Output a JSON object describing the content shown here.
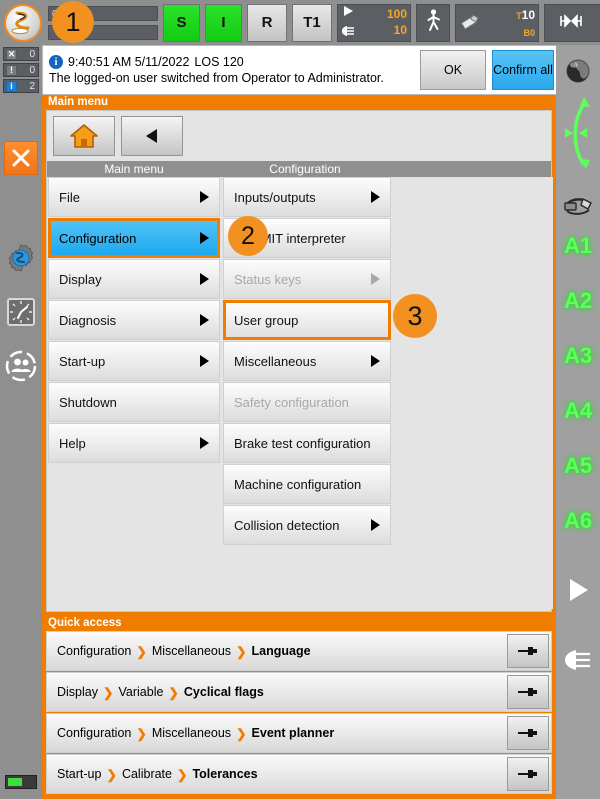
{
  "statusbar": {
    "robot_icon": "kuka-robot-icon",
    "submit_bars": [
      {
        "value": "0"
      },
      {
        "value": ""
      }
    ],
    "buttons": [
      {
        "name": "drives-ready-s",
        "label": "S",
        "state": "green"
      },
      {
        "name": "drives-i",
        "label": "I",
        "state": "green"
      },
      {
        "name": "robot-interpreter-r",
        "label": "R",
        "state": "gray"
      },
      {
        "name": "operating-mode-t1",
        "label": "T1",
        "state": "gray"
      }
    ],
    "override": {
      "program_value": "100",
      "jog_value": "10",
      "program_icon": "play-icon",
      "jog_icon": "hand-icon"
    },
    "increment_mode_icon": "walking-man-icon",
    "tool": {
      "icon": "tool-base-icon",
      "tool_label": "T",
      "tool_value": "10",
      "base_label": "B",
      "base_value": "0"
    },
    "increment": {
      "icon": "increment-icon",
      "value": "∞"
    }
  },
  "messagebar": {
    "counters": [
      {
        "icon": "error-icon",
        "count": "0"
      },
      {
        "icon": "warning-icon",
        "count": "0"
      },
      {
        "icon": "info-icon",
        "count": "2"
      }
    ],
    "info_icon": "info-icon",
    "timestamp": "9:40:51 AM 5/11/2022",
    "code": "LOS 120",
    "text": "The logged-on user switched from Operator to Administrator.",
    "ok_label": "OK",
    "confirm_all_label": "Confirm all"
  },
  "left_sidebar": {
    "counter_top": {
      "icon": "acknowledge-icon",
      "count": "0"
    },
    "close_icon": "close-x-icon",
    "items": [
      {
        "name": "robot-settings-icon"
      },
      {
        "name": "clock-icon"
      },
      {
        "name": "user-group-icon"
      }
    ],
    "battery_icon": "battery-icon"
  },
  "right_sidebar": {
    "globe_icon": "world-coordinates-icon",
    "arc_icon": "jog-direction-arc-icon",
    "tool_icon": "tool-icon",
    "axes": [
      "A1",
      "A2",
      "A3",
      "A4",
      "A5",
      "A6"
    ],
    "play_icon": "play-icon",
    "hand_icon": "hand-jog-icon"
  },
  "main_menu": {
    "panel_title": "Main menu",
    "home_button": "home-icon",
    "back_button": "back-arrow-icon",
    "column_headers": [
      "Main menu",
      "Configuration",
      ""
    ],
    "column1": [
      {
        "label": "File",
        "arrow": true,
        "state": "normal"
      },
      {
        "label": "Configuration",
        "arrow": true,
        "state": "selected"
      },
      {
        "label": "Display",
        "arrow": true,
        "state": "normal"
      },
      {
        "label": "Diagnosis",
        "arrow": true,
        "state": "normal"
      },
      {
        "label": "Start-up",
        "arrow": true,
        "state": "normal"
      },
      {
        "label": "Shutdown",
        "arrow": false,
        "state": "normal"
      },
      {
        "label": "Help",
        "arrow": true,
        "state": "normal"
      }
    ],
    "column2": [
      {
        "label": "Inputs/outputs",
        "arrow": true,
        "state": "normal"
      },
      {
        "label": "SUBMIT interpreter",
        "arrow": false,
        "state": "normal"
      },
      {
        "label": "Status keys",
        "arrow": true,
        "state": "disabled"
      },
      {
        "label": "User group",
        "arrow": false,
        "state": "outlined"
      },
      {
        "label": "Miscellaneous",
        "arrow": true,
        "state": "normal"
      },
      {
        "label": "Safety configuration",
        "arrow": false,
        "state": "disabled"
      },
      {
        "label": "Brake test configuration",
        "arrow": false,
        "state": "normal"
      },
      {
        "label": "Machine configuration",
        "arrow": false,
        "state": "normal"
      },
      {
        "label": "Collision detection",
        "arrow": true,
        "state": "normal"
      }
    ]
  },
  "quick_access": {
    "panel_title": "Quick access",
    "pin_icon": "pin-icon",
    "rows": [
      {
        "p1": "Configuration",
        "p2": "Miscellaneous",
        "p3": "Language"
      },
      {
        "p1": "Display",
        "p2": "Variable",
        "p3": "Cyclical flags"
      },
      {
        "p1": "Configuration",
        "p2": "Miscellaneous",
        "p3": "Event planner"
      },
      {
        "p1": "Start-up",
        "p2": "Calibrate",
        "p3": "Tolerances"
      }
    ],
    "separator": "❯"
  },
  "callouts": [
    {
      "number": "1"
    },
    {
      "number": "2"
    },
    {
      "number": "3"
    }
  ],
  "colors": {
    "accent_orange": "#f07d00",
    "selected_blue": "#1ea9ef",
    "status_green": "#2be12b",
    "axis_green": "#5dff5d"
  }
}
